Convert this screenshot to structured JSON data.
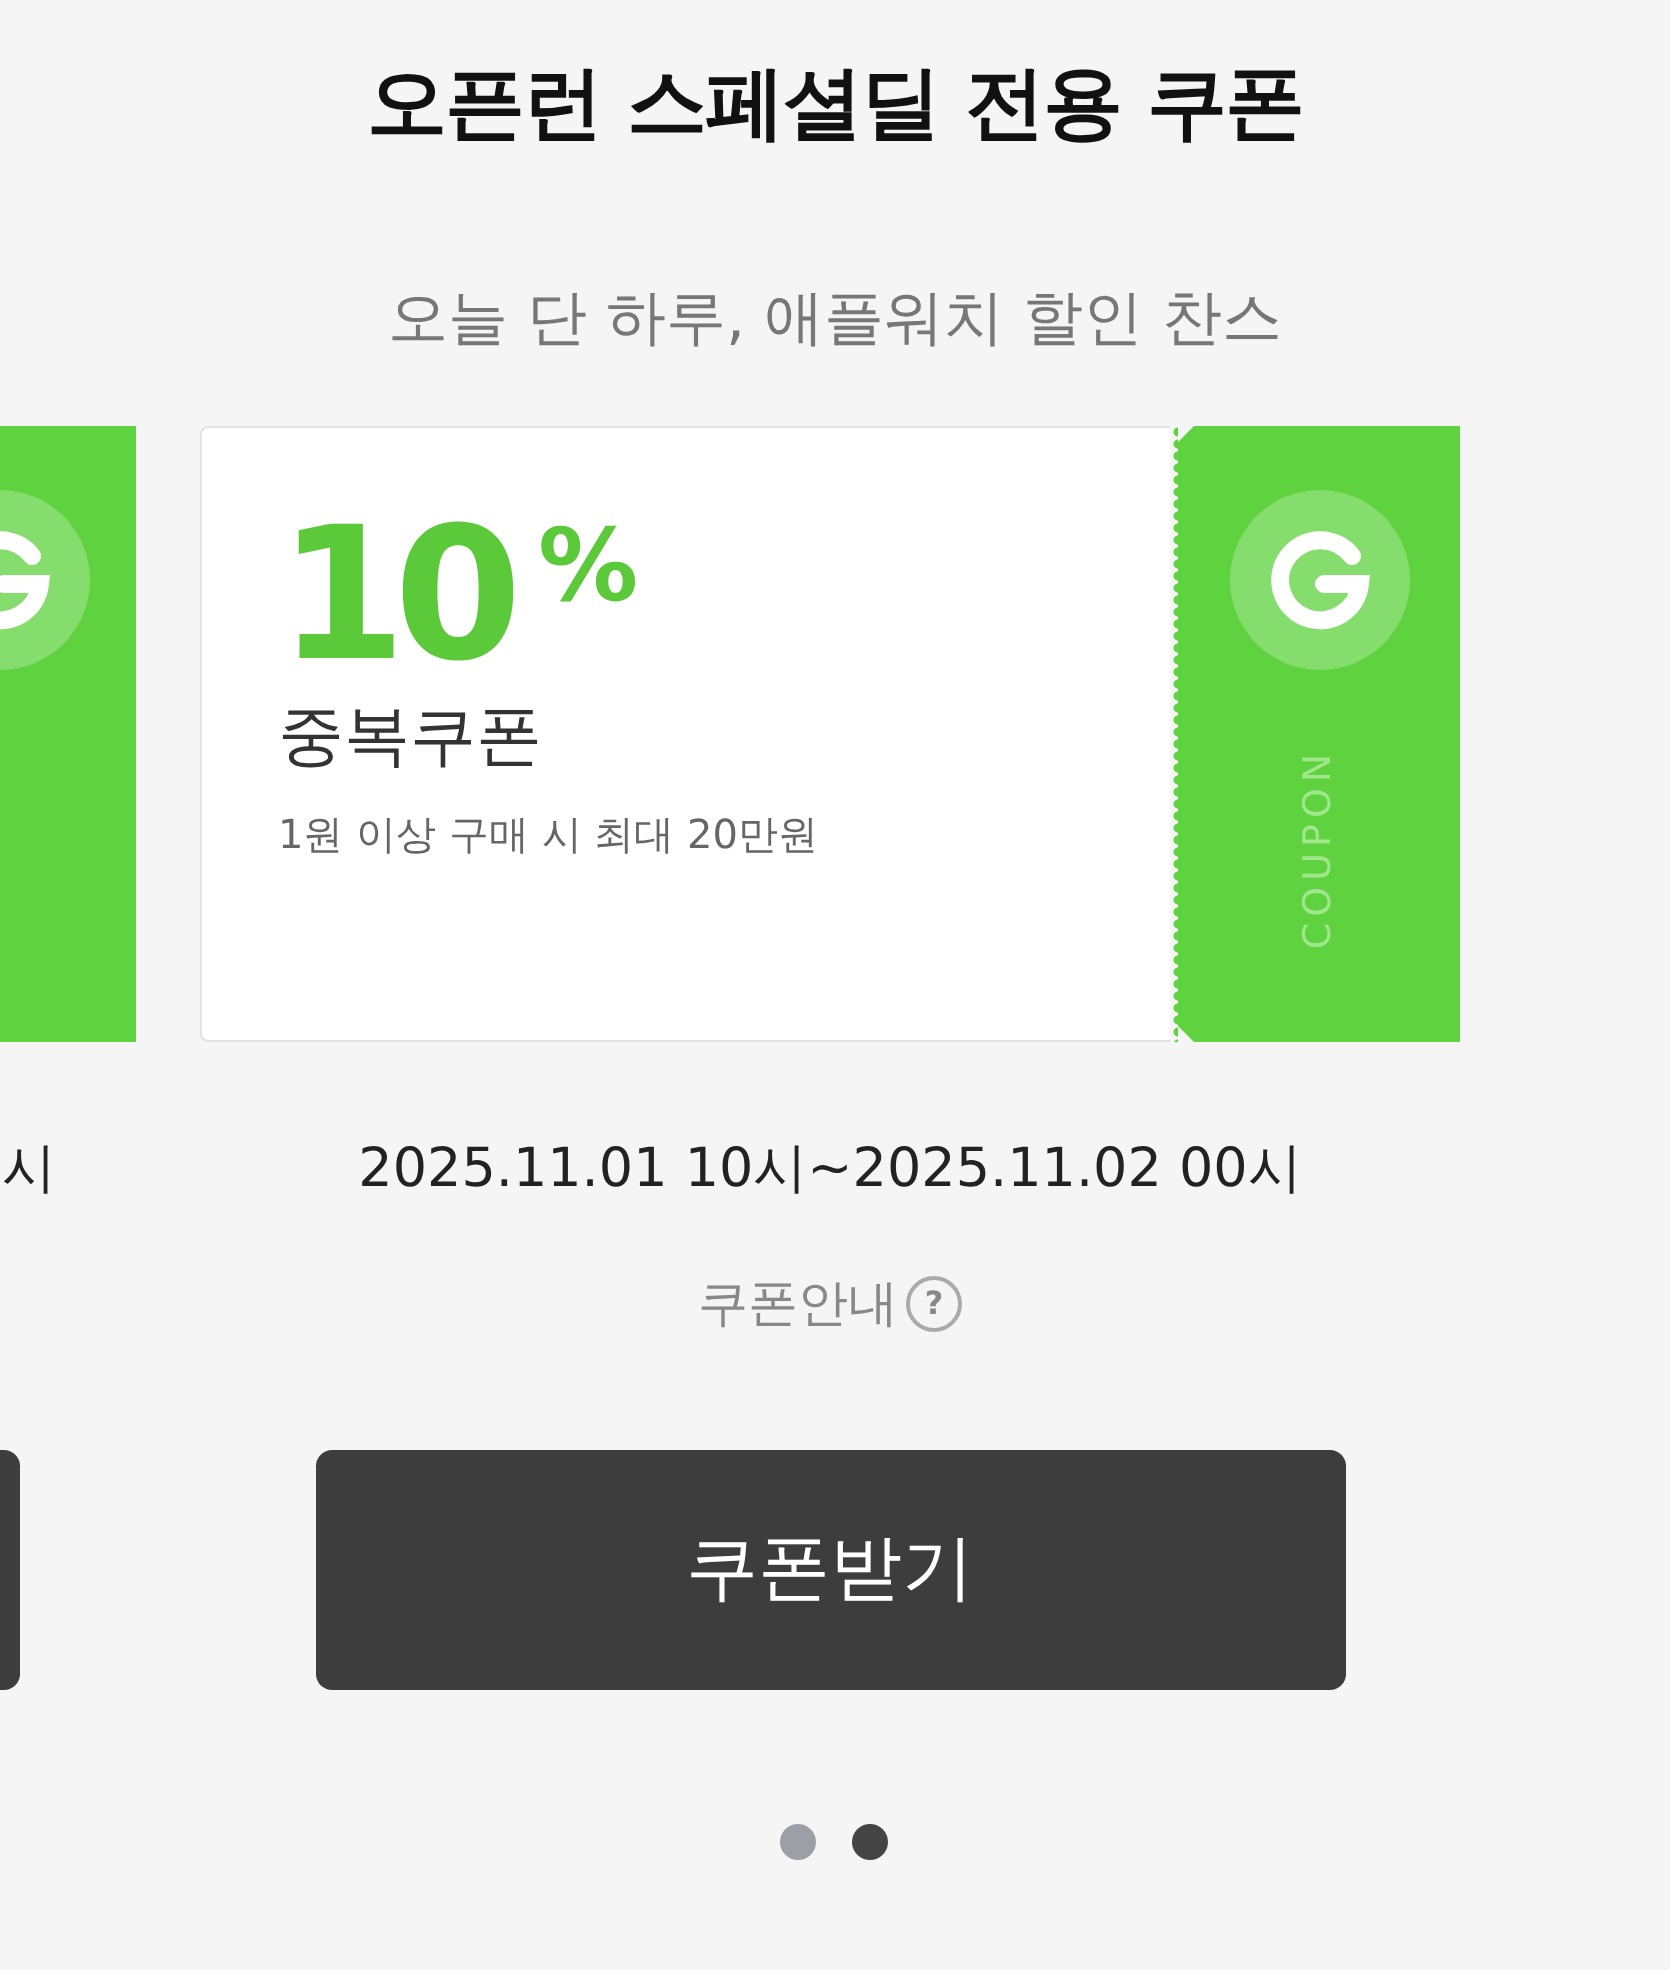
{
  "header": {
    "title": "오픈런 스페셜딜 전용 쿠폰",
    "subtitle": "오늘 단 하루, 애플워치 할인 찬스"
  },
  "slides": [
    {
      "kind": "peek",
      "period": "시"
    },
    {
      "kind": "full",
      "coupon": {
        "value": "10",
        "unit": "%",
        "name": "중복쿠폰",
        "condition": "1원 이상 구매 시 최대 20만원",
        "stub_label": "COUPON"
      },
      "period": "2025.11.01 10시~2025.11.02 00시",
      "info_link": "쿠폰안내",
      "help_icon": "?",
      "button": "쿠폰받기"
    }
  ],
  "dots": [
    {
      "selected": false
    },
    {
      "selected": true
    }
  ]
}
